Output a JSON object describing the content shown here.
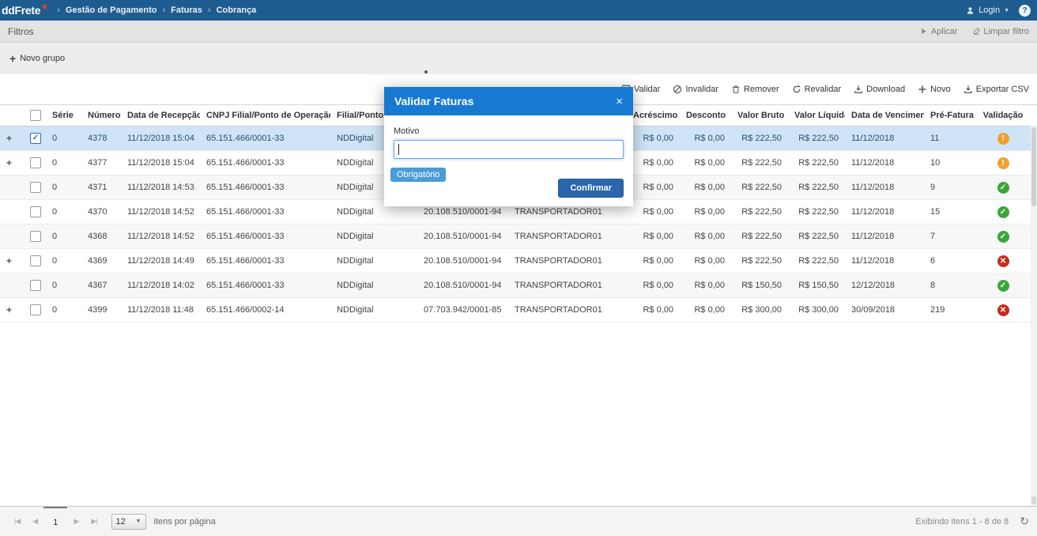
{
  "colors": {
    "topbar": "#1e5c90",
    "modal_header": "#1879d2",
    "confirm": "#2b66ad",
    "tooltip": "#4a9bd9",
    "selected_row": "#cfe4f6",
    "warning": "#f0a12d",
    "success": "#3aa63a",
    "error": "#c62b1a"
  },
  "icons": {
    "seek_first": "|◀",
    "seek_prev": "◀",
    "seek_next": "▶",
    "seek_last": "▶|",
    "refresh": "↻",
    "caret_down": "▼",
    "sort_desc": "↓",
    "plus": "+",
    "breadcrumb_sep": "›"
  },
  "topbar": {
    "logo_text": "ddFrete",
    "breadcrumb": [
      {
        "label": "Gestão de Pagamento"
      },
      {
        "label": "Faturas"
      },
      {
        "label": "Cobrança"
      }
    ],
    "login_label": "Login",
    "help_label": "?"
  },
  "filters": {
    "title": "Filtros",
    "apply_label": "Aplicar",
    "clear_label": "Limpar filtro"
  },
  "groups": {
    "new_group_label": "Novo grupo"
  },
  "toolbar": {
    "actions": [
      {
        "id": "validar",
        "label": "Validar",
        "icon": "check-square-icon"
      },
      {
        "id": "invalidar",
        "label": "Invalidar",
        "icon": "ban-icon"
      },
      {
        "id": "remover",
        "label": "Remover",
        "icon": "trash-icon"
      },
      {
        "id": "revalidar",
        "label": "Revalidar",
        "icon": "refresh-icon"
      },
      {
        "id": "download",
        "label": "Download",
        "icon": "download-icon"
      },
      {
        "id": "novo",
        "label": "Novo",
        "icon": "plus-icon"
      },
      {
        "id": "exportar-csv",
        "label": "Exportar CSV",
        "icon": "export-icon"
      }
    ]
  },
  "table": {
    "columns": [
      {
        "id": "expand",
        "label": "",
        "align": "left"
      },
      {
        "id": "select",
        "label": "",
        "align": "center"
      },
      {
        "id": "serie",
        "label": "Série",
        "align": "left"
      },
      {
        "id": "numero",
        "label": "Número",
        "align": "left"
      },
      {
        "id": "recepcao",
        "label": "Data de Recepção",
        "align": "left",
        "sort": "desc"
      },
      {
        "id": "cnpj_filial",
        "label": "CNPJ Filial/Ponto de Operação",
        "align": "left"
      },
      {
        "id": "filial",
        "label": "Filial/Ponto de Operação",
        "align": "left"
      },
      {
        "id": "cnpj_transportadora",
        "label": "",
        "align": "left"
      },
      {
        "id": "transportadora",
        "label": "",
        "align": "left"
      },
      {
        "id": "acrescimo",
        "label": "Acréscimo",
        "align": "right"
      },
      {
        "id": "desconto",
        "label": "Desconto",
        "align": "right"
      },
      {
        "id": "valor_bruto",
        "label": "Valor Bruto",
        "align": "right"
      },
      {
        "id": "valor_liquido",
        "label": "Valor Líquido",
        "align": "right"
      },
      {
        "id": "vencimento",
        "label": "Data de Vencimento",
        "align": "left"
      },
      {
        "id": "pre_fatura",
        "label": "Pré-Fatura",
        "align": "left"
      },
      {
        "id": "validacao",
        "label": "Validação",
        "align": "center"
      }
    ],
    "rows": [
      {
        "expand": true,
        "checked": true,
        "selected": true,
        "serie": "0",
        "numero": "4378",
        "recepcao": "11/12/2018 15:04",
        "cnpj_filial": "65.151.466/0001-33",
        "filial": "NDDigital",
        "cnpj_transportadora": "",
        "transportadora": "",
        "acrescimo": "R$ 0,00",
        "desconto": "R$ 0,00",
        "valor_bruto": "R$ 222,50",
        "valor_liquido": "R$ 222,50",
        "vencimento": "11/12/2018",
        "pre_fatura": "11",
        "validacao": "warning"
      },
      {
        "expand": true,
        "checked": false,
        "selected": false,
        "serie": "0",
        "numero": "4377",
        "recepcao": "11/12/2018 15:04",
        "cnpj_filial": "65.151.466/0001-33",
        "filial": "NDDigital",
        "cnpj_transportadora": "",
        "transportadora": "",
        "acrescimo": "R$ 0,00",
        "desconto": "R$ 0,00",
        "valor_bruto": "R$ 222,50",
        "valor_liquido": "R$ 222,50",
        "vencimento": "11/12/2018",
        "pre_fatura": "10",
        "validacao": "warning"
      },
      {
        "expand": false,
        "checked": false,
        "selected": false,
        "serie": "0",
        "numero": "4371",
        "recepcao": "11/12/2018 14:53",
        "cnpj_filial": "65.151.466/0001-33",
        "filial": "NDDigital",
        "cnpj_transportadora": "",
        "transportadora": "",
        "acrescimo": "R$ 0,00",
        "desconto": "R$ 0,00",
        "valor_bruto": "R$ 222,50",
        "valor_liquido": "R$ 222,50",
        "vencimento": "11/12/2018",
        "pre_fatura": "9",
        "validacao": "success"
      },
      {
        "expand": false,
        "checked": false,
        "selected": false,
        "serie": "0",
        "numero": "4370",
        "recepcao": "11/12/2018 14:52",
        "cnpj_filial": "65.151.466/0001-33",
        "filial": "NDDigital",
        "cnpj_transportadora": "20.108.510/0001-94",
        "transportadora": "TRANSPORTADOR01",
        "acrescimo": "R$ 0,00",
        "desconto": "R$ 0,00",
        "valor_bruto": "R$ 222,50",
        "valor_liquido": "R$ 222,50",
        "vencimento": "11/12/2018",
        "pre_fatura": "15",
        "validacao": "success"
      },
      {
        "expand": false,
        "checked": false,
        "selected": false,
        "serie": "0",
        "numero": "4368",
        "recepcao": "11/12/2018 14:52",
        "cnpj_filial": "65.151.466/0001-33",
        "filial": "NDDigital",
        "cnpj_transportadora": "20.108.510/0001-94",
        "transportadora": "TRANSPORTADOR01",
        "acrescimo": "R$ 0,00",
        "desconto": "R$ 0,00",
        "valor_bruto": "R$ 222,50",
        "valor_liquido": "R$ 222,50",
        "vencimento": "11/12/2018",
        "pre_fatura": "7",
        "validacao": "success"
      },
      {
        "expand": true,
        "checked": false,
        "selected": false,
        "serie": "0",
        "numero": "4369",
        "recepcao": "11/12/2018 14:49",
        "cnpj_filial": "65.151.466/0001-33",
        "filial": "NDDigital",
        "cnpj_transportadora": "20.108.510/0001-94",
        "transportadora": "TRANSPORTADOR01",
        "acrescimo": "R$ 0,00",
        "desconto": "R$ 0,00",
        "valor_bruto": "R$ 222,50",
        "valor_liquido": "R$ 222,50",
        "vencimento": "11/12/2018",
        "pre_fatura": "6",
        "validacao": "error"
      },
      {
        "expand": false,
        "checked": false,
        "selected": false,
        "serie": "0",
        "numero": "4367",
        "recepcao": "11/12/2018 14:02",
        "cnpj_filial": "65.151.466/0001-33",
        "filial": "NDDigital",
        "cnpj_transportadora": "20.108.510/0001-94",
        "transportadora": "TRANSPORTADOR01",
        "acrescimo": "R$ 0,00",
        "desconto": "R$ 0,00",
        "valor_bruto": "R$ 150,50",
        "valor_liquido": "R$ 150,50",
        "vencimento": "12/12/2018",
        "pre_fatura": "8",
        "validacao": "success"
      },
      {
        "expand": true,
        "checked": false,
        "selected": false,
        "serie": "0",
        "numero": "4399",
        "recepcao": "11/12/2018 11:48",
        "cnpj_filial": "65.151.466/0002-14",
        "filial": "NDDigital",
        "cnpj_transportadora": "07.703.942/0001-85",
        "transportadora": "TRANSPORTADOR01",
        "acrescimo": "R$ 0,00",
        "desconto": "R$ 0,00",
        "valor_bruto": "R$ 300,00",
        "valor_liquido": "R$ 300,00",
        "vencimento": "30/09/2018",
        "pre_fatura": "219",
        "validacao": "error"
      }
    ]
  },
  "pager": {
    "current_page": "1",
    "page_size": "12",
    "items_per_page_label": "itens por página",
    "status": "Exibindo itens 1 - 8 de 8"
  },
  "modal": {
    "title": "Validar Faturas",
    "close_label": "×",
    "motivo_label": "Motivo",
    "input_value": "",
    "tooltip": "Obrigatório",
    "confirm_label": "Confirmar"
  }
}
